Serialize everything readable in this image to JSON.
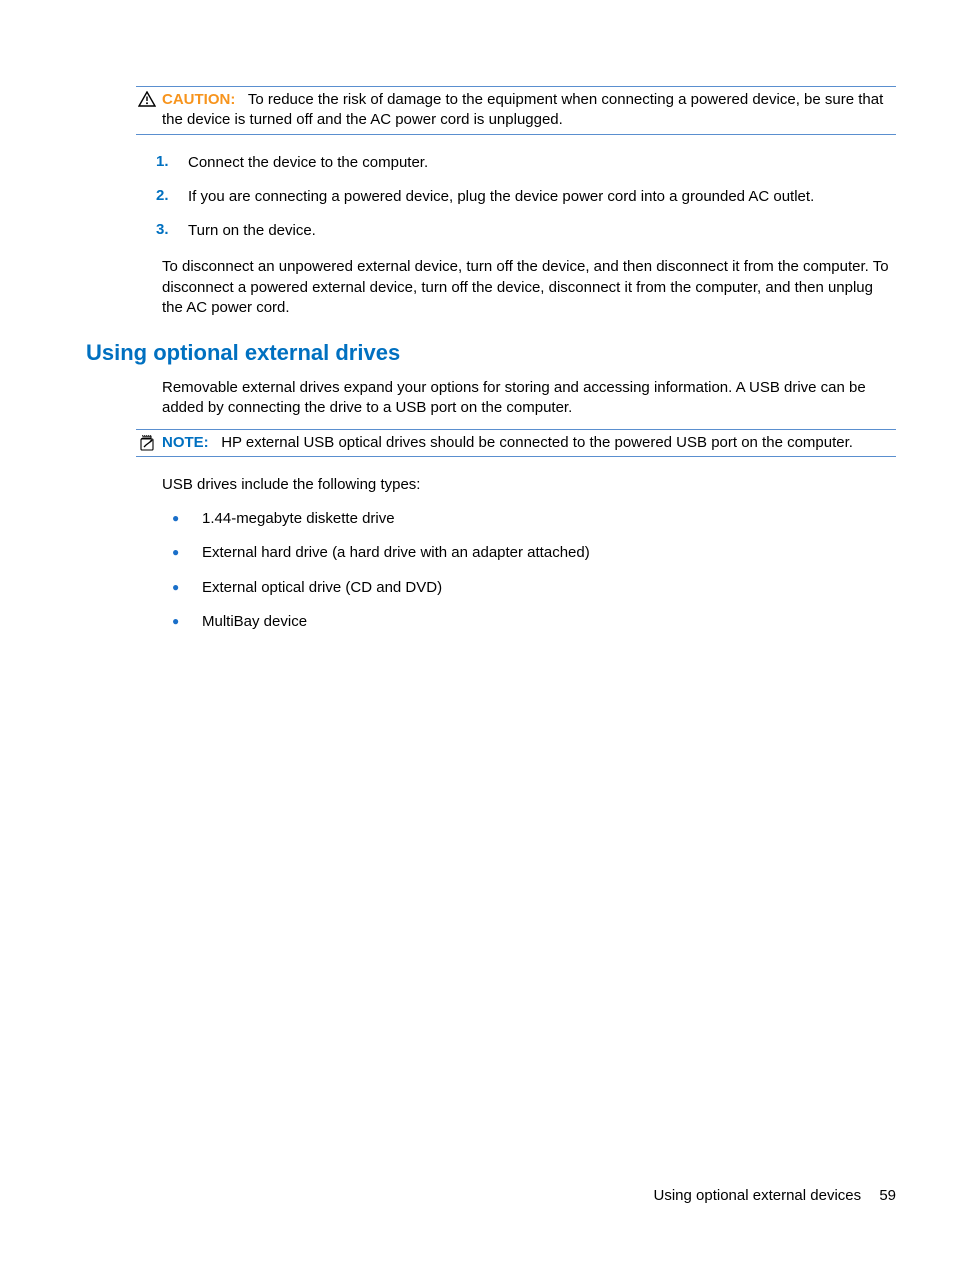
{
  "caution": {
    "label": "CAUTION:",
    "text": "To reduce the risk of damage to the equipment when connecting a powered device, be sure that the device is turned off and the AC power cord is unplugged."
  },
  "steps": [
    {
      "num": "1.",
      "text": "Connect the device to the computer."
    },
    {
      "num": "2.",
      "text": "If you are connecting a powered device, plug the device power cord into a grounded AC outlet."
    },
    {
      "num": "3.",
      "text": "Turn on the device."
    }
  ],
  "disconnect_para": "To disconnect an unpowered external device, turn off the device, and then disconnect it from the computer. To disconnect a powered external device, turn off the device, disconnect it from the computer, and then unplug the AC power cord.",
  "section_heading": "Using optional external drives",
  "intro_para": "Removable external drives expand your options for storing and accessing information. A USB drive can be added by connecting the drive to a USB port on the computer.",
  "note": {
    "label": "NOTE:",
    "text": "HP external USB optical drives should be connected to the powered USB port on the computer."
  },
  "types_para": "USB drives include the following types:",
  "types": [
    "1.44-megabyte diskette drive",
    "External hard drive (a hard drive with an adapter attached)",
    "External optical drive (CD and DVD)",
    "MultiBay device"
  ],
  "footer": {
    "title": "Using optional external devices",
    "page": "59"
  }
}
